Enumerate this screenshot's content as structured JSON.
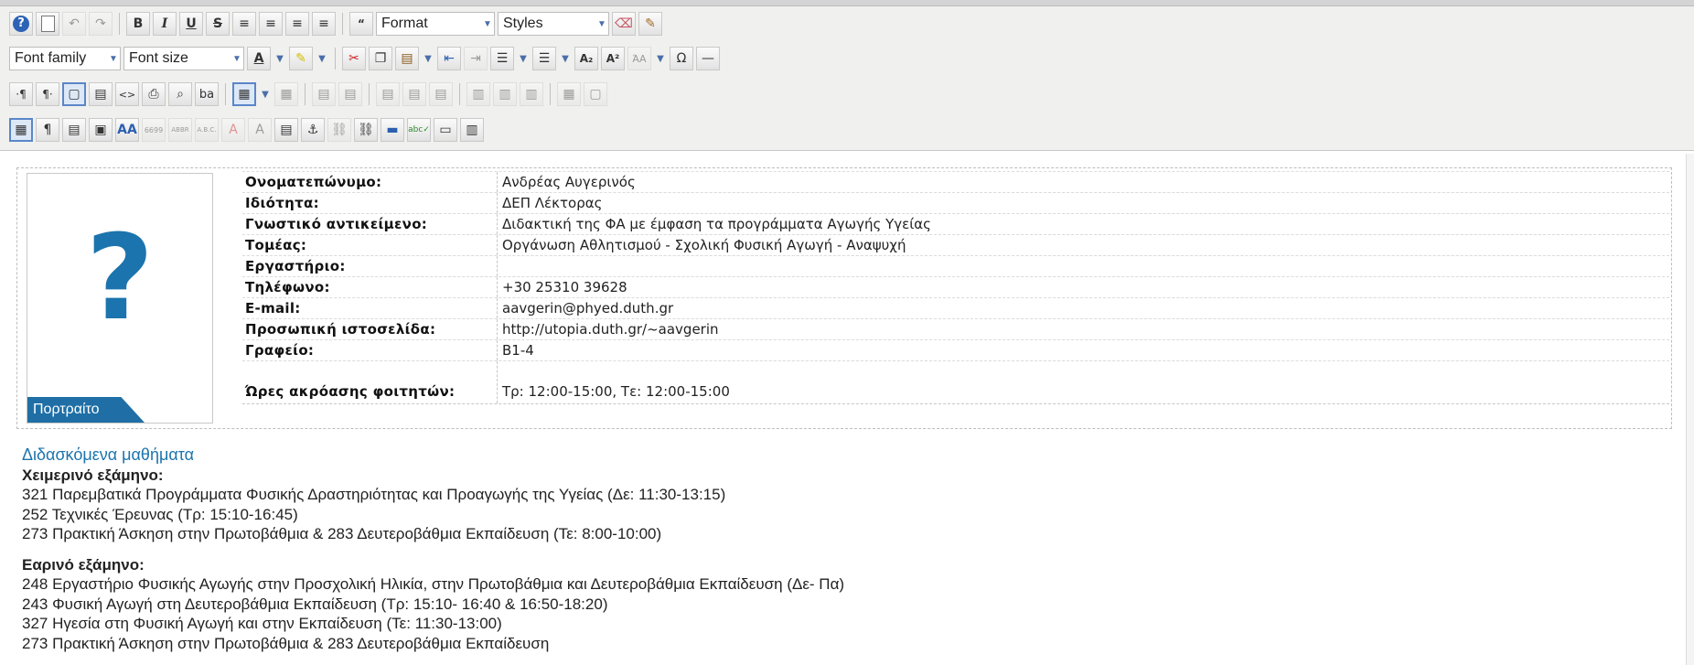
{
  "toolbar": {
    "format_label": "Format",
    "styles_label": "Styles",
    "font_family_label": "Font family",
    "font_size_label": "Font size",
    "bold": "B",
    "italic": "I",
    "underline": "U",
    "strike": "S"
  },
  "profile": {
    "portrait_label": "Πορτραίτο",
    "portrait_placeholder": "?",
    "fields": [
      {
        "label": "Ονοματεπώνυμο:",
        "value": "Ανδρέας Αυγερινός"
      },
      {
        "label": "Ιδιότητα:",
        "value": "ΔΕΠ Λέκτορας"
      },
      {
        "label": "Γνωστικό αντικείμενο:",
        "value": "Διδακτική της ΦΑ με έμφαση τα προγράμματα Αγωγής Υγείας"
      },
      {
        "label": "Τομέας:",
        "value": "Οργάνωση Αθλητισμού - Σχολική Φυσική Αγωγή - Αναψυχή"
      },
      {
        "label": "Εργαστήριο:",
        "value": ""
      },
      {
        "label": "Τηλέφωνο:",
        "value": "+30 25310 39628"
      },
      {
        "label": "E-mail:",
        "value": "aavgerin@phyed.duth.gr"
      },
      {
        "label": "Προσωπική ιστοσελίδα:",
        "value": "http://utopia.duth.gr/~aavgerin"
      },
      {
        "label": "Γραφείο:",
        "value": "Β1-4"
      },
      {
        "label": "Ώρες ακρόασης φοιτητών:",
        "value": "Τρ: 12:00-15:00, Τε: 12:00-15:00"
      }
    ]
  },
  "courses": {
    "heading": "Διδασκόμενα μαθήματα",
    "winter_label": "Χειμερινό εξάμηνο:",
    "winter": [
      "321 Παρεμβατικά Προγράμματα Φυσικής Δραστηριότητας και Προαγωγής της Υγείας (Δε: 11:30-13:15)",
      "252 Τεχνικές Έρευνας (Τρ: 15:10-16:45)",
      "273 Πρακτική Άσκηση στην Πρωτοβάθμια & 283 Δευτεροβάθμια Εκπαίδευση (Τε: 8:00-10:00)"
    ],
    "spring_label": "Εαρινό εξάμηνο:",
    "spring": [
      "248 Εργαστήριο Φυσικής Αγωγής στην Προσχολική Ηλικία, στην Πρωτοβάθμια και Δευτεροβάθμια Εκπαίδευση (Δε- Πα)",
      "243 Φυσική Αγωγή στη Δευτεροβάθμια Εκπαίδευση (Τρ: 15:10- 16:40 & 16:50-18:20)",
      "327 Ηγεσία στη Φυσική Αγωγή και στην Εκπαίδευση (Τε: 11:30-13:00)",
      "273 Πρακτική Άσκηση στην Πρωτοβάθμια & 283 Δευτεροβάθμια Εκπαίδευση"
    ]
  }
}
